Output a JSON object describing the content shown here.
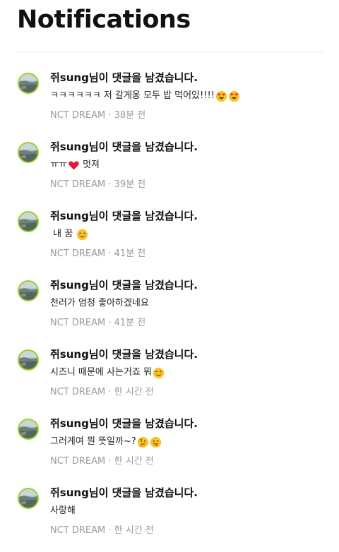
{
  "page": {
    "title": "Notifications"
  },
  "notifications": [
    {
      "headline": "쥐sung님이 댓글을 남겼습니다.",
      "comment": "ㅋㅋㅋㅋㅋㅋ 저 갈게옹 모두 밥 먹어있!!!!",
      "emojis": [
        "heart-eyes",
        "heart-eyes"
      ],
      "group": "NCT DREAM",
      "time": "38분 전"
    },
    {
      "headline": "쥐sung님이 댓글을 남겼습니다.",
      "comment": "ㅠㅠ",
      "emojis": [
        "red-heart"
      ],
      "comment_after": " 멋져",
      "group": "NCT DREAM",
      "time": "39분 전"
    },
    {
      "headline": "쥐sung님이 댓글을 남겼습니다.",
      "comment": " 내 꿈 ",
      "emojis": [
        "smiling-blush"
      ],
      "group": "NCT DREAM",
      "time": "41분 전"
    },
    {
      "headline": "쥐sung님이 댓글을 남겼습니다.",
      "comment": "천러가 엄청 좋아하겠네요",
      "emojis": [],
      "group": "NCT DREAM",
      "time": "41분 전"
    },
    {
      "headline": "쥐sung님이 댓글을 남겼습니다.",
      "comment": "시즈니 때문에 사는거죠 뭐",
      "emojis": [
        "smiling-blush"
      ],
      "group": "NCT DREAM",
      "time": "한 시간 전"
    },
    {
      "headline": "쥐sung님이 댓글을 남겼습니다.",
      "comment": "그러게여 뭔 뜻일까~?",
      "emojis": [
        "thinking",
        "tongue-wink"
      ],
      "group": "NCT DREAM",
      "time": "한 시간 전"
    },
    {
      "headline": "쥐sung님이 댓글을 남겼습니다.",
      "comment": "사랑해",
      "emojis": [],
      "group": "NCT DREAM",
      "time": "한 시간 전"
    }
  ],
  "meta_separator": " · ",
  "colors": {
    "avatar_ring": "#9fd321",
    "meta_text": "#9a9a9a",
    "divider": "#e6e6e6",
    "emoji_face": "#f7c325",
    "heart": "#e0193a"
  }
}
